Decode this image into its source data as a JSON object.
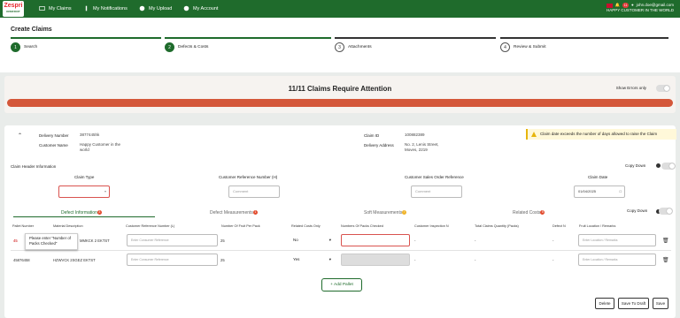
{
  "brand": {
    "name": "Zespri",
    "tagline": "KIWIFRUIT",
    "color": "#1f6b2c",
    "alert_color": "#d4573a"
  },
  "nav": [
    {
      "label": "My Claims",
      "icon": "claims-icon"
    },
    {
      "label": "My Notifications",
      "icon": "bell-icon"
    },
    {
      "label": "My Upload",
      "icon": "upload-icon"
    },
    {
      "label": "My Account",
      "icon": "account-icon"
    }
  ],
  "user": {
    "email": "john.doe@gmail.com",
    "customer": "HAPPY CUSTOMER IN THE WORLD",
    "notifications": "11"
  },
  "page": {
    "title": "Create Claims"
  },
  "steps": [
    {
      "num": "1",
      "label": "Search"
    },
    {
      "num": "2",
      "label": "Defects & Costs"
    },
    {
      "num": "3",
      "label": "Attachments"
    },
    {
      "num": "4",
      "label": "Review & Submit"
    }
  ],
  "attention": {
    "title": "11/11 Claims Require Attention",
    "toggle_label": "Show Errors only"
  },
  "delivery": {
    "number_label": "Delivery Number",
    "number": "3877445hk",
    "customer_label": "Customer Name",
    "customer": "Happy Customer in the world",
    "claim_label": "Claim ID",
    "claim": "100882389",
    "address_label": "Delivery Address",
    "address": "No. 2, Lenis Street, Moves, 2219"
  },
  "warning": "Claim date exceeds the number of days allowed to raise the Claim",
  "claim_header": {
    "title": "Claim Header Information",
    "copy_label": "Copy Down",
    "claim_type": "Claim Type",
    "cust_ref": "Customer Reference Number (H)",
    "cust_ref_ph": "Comment",
    "sales_order": "Customer Sales Order Reference",
    "sales_ph": "Comment",
    "claim_date": "Claim Date",
    "date_value": "01/04/2025"
  },
  "tabs": [
    {
      "label": "Defect Information",
      "count": "3"
    },
    {
      "label": "Defect Measurements",
      "count": "1"
    },
    {
      "label": "Soft Measurements",
      "count": "!"
    },
    {
      "label": "Related Costs",
      "count": "5"
    }
  ],
  "copy_down": "Copy Down",
  "table": {
    "headers": [
      "Pallet Number",
      "Material Description",
      "Customer Reference Number (L)",
      "Number Of Fruit Per Pack",
      "Related Costs Only",
      "Numbers Of Packs Checked",
      "Customer Inspection N",
      "Total Claims Quantity (Packs)",
      "Defect N",
      "Fruit Location / Remarks"
    ],
    "rows": [
      {
        "pallet": "45",
        "material": "MMKCK 2 EKTST",
        "ref_ph": "Enter Consumer Reference",
        "fruit": "25",
        "costs": "No",
        "inspection": "-",
        "total": "-",
        "defect": "-",
        "remarks_ph": "Enter Location / Remarks"
      },
      {
        "pallet": "45876458",
        "material": "HZWVCK 2SGEZ EKTST",
        "ref_ph": "Enter Consumer Reference",
        "fruit": "25",
        "costs": "Yes",
        "inspection": "-",
        "total": "-",
        "defect": "-",
        "remarks_ph": "Enter Location / Remarks"
      }
    ]
  },
  "tooltip": "Please enter \"Number of Packs Checked\"",
  "add_pallet": "+ Add Pallet",
  "buttons": {
    "delete": "Delete",
    "draft": "Save To Draft",
    "save": "Save"
  }
}
